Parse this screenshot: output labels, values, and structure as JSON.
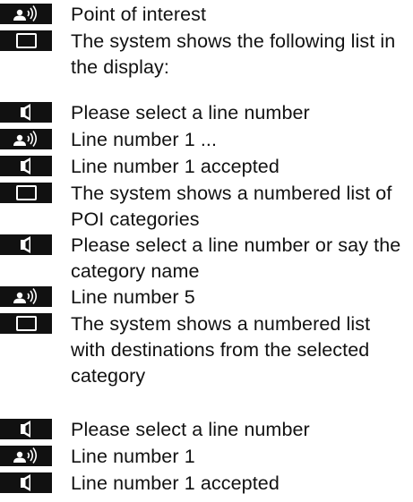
{
  "dialog": {
    "rows": [
      {
        "icon": "speaker-voice-icon",
        "text": "Point of interest"
      },
      {
        "icon": "display-screen-icon",
        "text": "The system shows the following list in the display:"
      },
      {
        "icon": "loudspeaker-icon",
        "text": "Please select a line number"
      },
      {
        "icon": "speaker-voice-icon",
        "text": "Line number 1 ..."
      },
      {
        "icon": "loudspeaker-icon",
        "text": "Line number 1 accepted"
      },
      {
        "icon": "display-screen-icon",
        "text": "The system shows a numbered list of POI categories"
      },
      {
        "icon": "loudspeaker-icon",
        "text": "Please select a line number or say the category name"
      },
      {
        "icon": "speaker-voice-icon",
        "text": "Line number 5"
      },
      {
        "icon": "display-screen-icon",
        "text": "The system shows a numbered list with destinations from the selected category"
      },
      {
        "icon": "loudspeaker-icon",
        "text": "Please select a line number"
      },
      {
        "icon": "speaker-voice-icon",
        "text": "Line number 1"
      },
      {
        "icon": "loudspeaker-icon",
        "text": "Line number 1 accepted"
      }
    ]
  }
}
